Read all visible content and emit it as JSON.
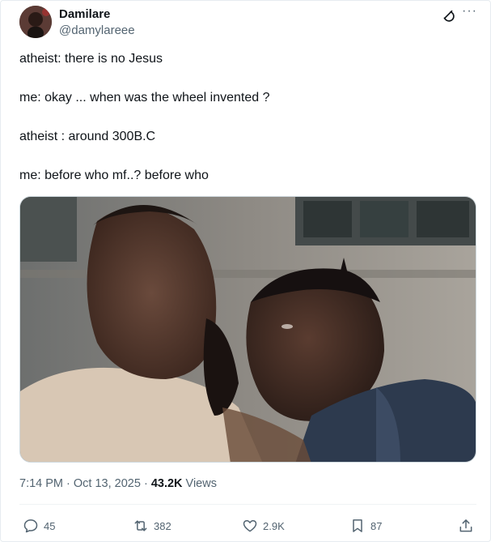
{
  "author": {
    "name": "Damilare",
    "handle": "@damylareee"
  },
  "tweet": {
    "lines": [
      "atheist: there is no Jesus",
      "me: okay ... when was the wheel invented ?",
      "atheist : around 300B.C",
      "me: before who mf..? before who"
    ]
  },
  "meta": {
    "time": "7:14 PM",
    "date": "Oct 13, 2025",
    "views_count": "43.2K",
    "views_label": "Views"
  },
  "actions": {
    "replies": "45",
    "reposts": "382",
    "likes": "2.9K",
    "bookmarks": "87"
  },
  "icons": [
    "grok-icon",
    "more-icon",
    "reply-icon",
    "repost-icon",
    "like-icon",
    "bookmark-icon",
    "share-icon"
  ],
  "colors": {
    "text": "#0f1419",
    "secondary": "#536471",
    "border": "#cfd9de"
  }
}
